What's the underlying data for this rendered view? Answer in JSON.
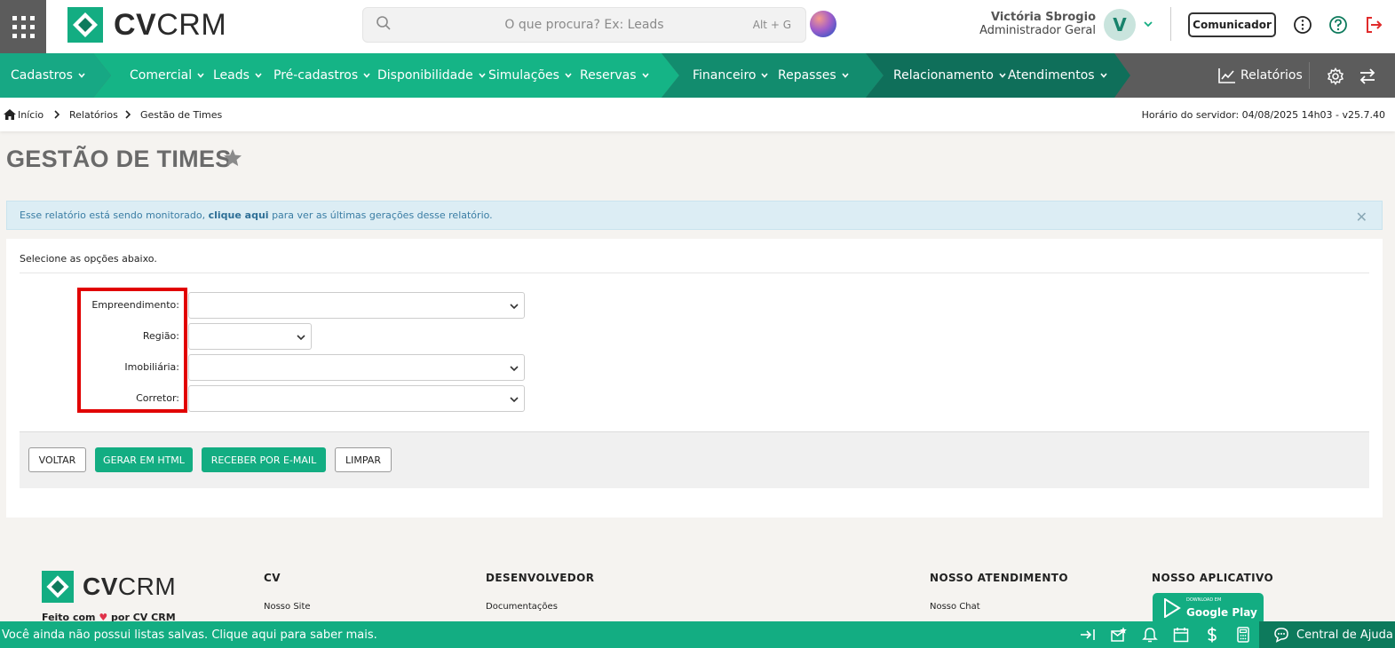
{
  "brand": {
    "word_bold": "CV",
    "word_light": "CRM"
  },
  "search": {
    "placeholder": "O que procura? Ex: Leads",
    "shortcut": "Alt + G"
  },
  "user": {
    "name": "Victória Sbrogio",
    "role": "Administrador Geral",
    "initial": "V"
  },
  "header": {
    "comunicador_label": "Comunicador"
  },
  "nav": {
    "items": [
      {
        "label": "Cadastros"
      },
      {
        "label": "Comercial"
      },
      {
        "label": "Leads"
      },
      {
        "label": "Pré-cadastros"
      },
      {
        "label": "Disponibilidade"
      },
      {
        "label": "Simulações"
      },
      {
        "label": "Reservas"
      },
      {
        "label": "Financeiro"
      },
      {
        "label": "Repasses"
      },
      {
        "label": "Relacionamento"
      },
      {
        "label": "Atendimentos"
      }
    ],
    "reports_label": "Relatórios"
  },
  "breadcrumb": {
    "home": "Início",
    "reports": "Relatórios",
    "current": "Gestão de Times"
  },
  "server_time": "Horário do servidor: 04/08/2025 14h03 - v25.7.40",
  "page": {
    "title": "GESTÃO DE TIMES"
  },
  "alert": {
    "prefix": "Esse relatório está sendo monitorado,",
    "link": "clique aqui",
    "suffix": "para ver as últimas gerações desse relatório."
  },
  "form": {
    "intro": "Selecione as opções abaixo.",
    "fields": [
      {
        "label": "Empreendimento:",
        "value": ""
      },
      {
        "label": "Região:",
        "value": ""
      },
      {
        "label": "Imobiliária:",
        "value": ""
      },
      {
        "label": "Corretor:",
        "value": ""
      }
    ],
    "buttons": {
      "back": "VOLTAR",
      "html": "GERAR EM HTML",
      "email": "RECEBER POR E-MAIL",
      "clear": "LIMPAR"
    }
  },
  "footer": {
    "made_prefix": "Feito com",
    "made_suffix": "por CV CRM",
    "columns": [
      {
        "title": "CV",
        "link": "Nosso Site"
      },
      {
        "title": "DESENVOLVEDOR",
        "link": "Documentações"
      },
      {
        "title": "NOSSO ATENDIMENTO",
        "link": "Nosso Chat"
      },
      {
        "title": "NOSSO APLICATIVO"
      }
    ],
    "gplay_small": "DOWNLOAD EM",
    "gplay_big": "Google Play"
  },
  "bottom": {
    "message": "Você ainda não possui listas salvas. Clique aqui para saber mais.",
    "help_label": "Central de Ajuda"
  },
  "colors": {
    "brand_green": "#13ad82",
    "nav_gray": "#5c5c5c",
    "highlight_red": "#e10000"
  }
}
